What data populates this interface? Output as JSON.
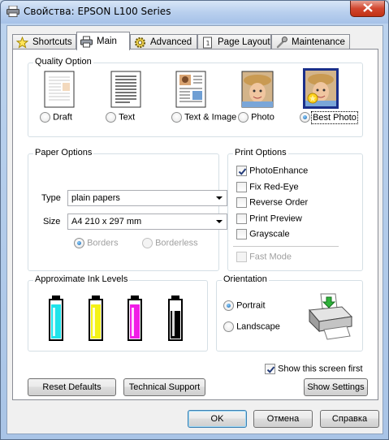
{
  "window": {
    "title": "Свойства: EPSON L100 Series"
  },
  "tabs": [
    {
      "label": "Shortcuts",
      "icon": "star-icon"
    },
    {
      "label": "Main",
      "icon": "printer-icon",
      "active": true
    },
    {
      "label": "Advanced",
      "icon": "gear-icon"
    },
    {
      "label": "Page Layout",
      "icon": "page-icon"
    },
    {
      "label": "Maintenance",
      "icon": "wrench-icon"
    }
  ],
  "quality": {
    "title": "Quality Option",
    "options": [
      {
        "label": "Draft",
        "selected": false
      },
      {
        "label": "Text",
        "selected": false
      },
      {
        "label": "Text & Image",
        "selected": false
      },
      {
        "label": "Photo",
        "selected": false
      },
      {
        "label": "Best Photo",
        "selected": true
      }
    ]
  },
  "paper": {
    "title": "Paper Options",
    "type_label": "Type",
    "type_value": "plain papers",
    "size_label": "Size",
    "size_value": "A4 210 x 297 mm",
    "borders_label": "Borders",
    "borderless_label": "Borderless"
  },
  "print_options": {
    "title": "Print Options",
    "items": [
      {
        "label": "PhotoEnhance",
        "checked": true
      },
      {
        "label": "Fix Red-Eye",
        "checked": false
      },
      {
        "label": "Reverse Order",
        "checked": false
      },
      {
        "label": "Print Preview",
        "checked": false
      },
      {
        "label": "Grayscale",
        "checked": false
      }
    ],
    "fast_mode_label": "Fast Mode"
  },
  "ink": {
    "title": "Approximate Ink Levels",
    "cartridges": [
      {
        "color_name": "cyan",
        "color": "#1fe3ea",
        "level": 0.88
      },
      {
        "color_name": "yellow",
        "color": "#f4f218",
        "level": 0.88
      },
      {
        "color_name": "magenta",
        "color": "#f01de6",
        "level": 0.88
      },
      {
        "color_name": "black",
        "color": "#000000",
        "level": 0.7
      }
    ]
  },
  "orientation": {
    "title": "Orientation",
    "portrait_label": "Portrait",
    "landscape_label": "Landscape",
    "selected": "Portrait"
  },
  "show_first_label": "Show this screen first",
  "buttons": {
    "reset": "Reset Defaults",
    "support": "Technical Support",
    "show_settings": "Show Settings",
    "ok": "OK",
    "cancel": "Отмена",
    "help": "Справка"
  },
  "colors": {
    "accent": "#3c7fb1",
    "selection": "#1a2f8a"
  }
}
